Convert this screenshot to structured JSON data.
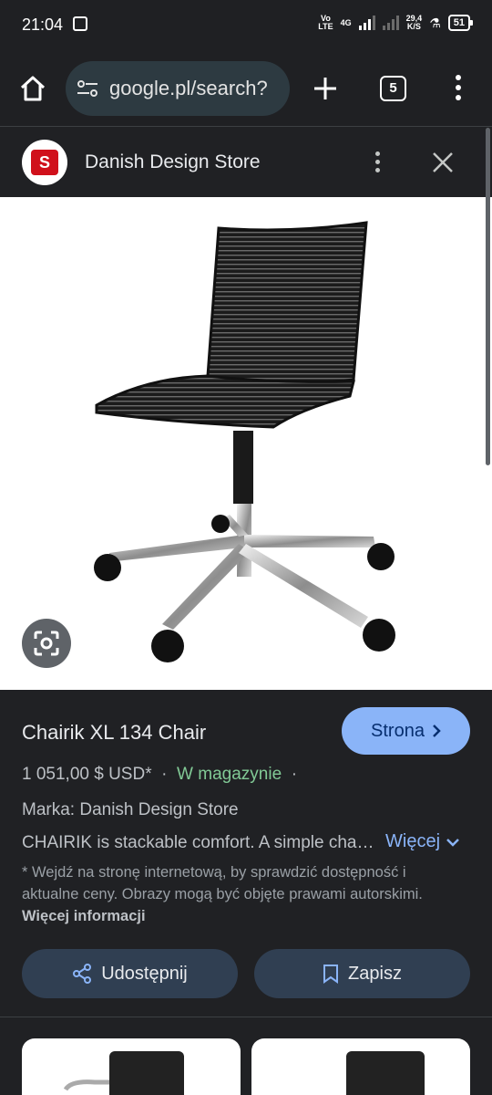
{
  "status_bar": {
    "time": "21:04",
    "network_top": "Vo",
    "network_bottom": "LTE",
    "network_4g": "4G",
    "speed_value": "29,4",
    "speed_unit": "K/S",
    "battery": "51"
  },
  "browser": {
    "url": "google.pl/search?",
    "tab_count": "5"
  },
  "panel": {
    "store_name": "Danish Design Store",
    "logo_letter": "S"
  },
  "product": {
    "title": "Chairik XL 134 Chair",
    "visit_button": "Strona",
    "price": "1 051,00 $ USD*",
    "separator": "·",
    "stock": "W magazynie",
    "brand": "Marka: Danish Design Store",
    "description": "CHAIRIK is stackable comfort. A simple chair with a flexible shell.",
    "more_label": "Więcej",
    "disclaimer": "* Wejdź na stronę internetową, by sprawdzić dostępność i aktualne ceny. Obrazy mogą być objęte prawami autorskimi.",
    "more_info_label": "Więcej informacji",
    "share_label": "Udostępnij",
    "save_label": "Zapisz"
  },
  "colors": {
    "accent": "#8ab4f8",
    "stock_green": "#81c995",
    "background": "#202124",
    "button_bg": "#303f52"
  }
}
